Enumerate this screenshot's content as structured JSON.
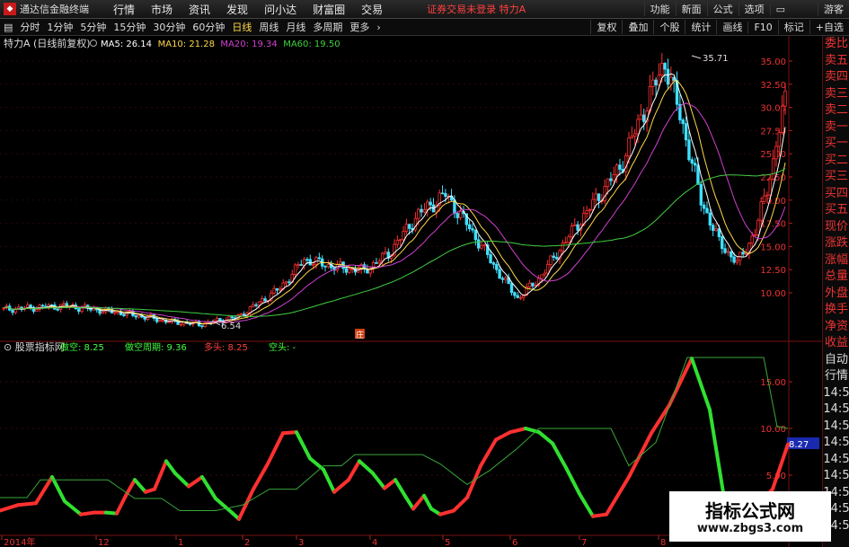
{
  "titlebar": {
    "app_title": "通达信金融终端",
    "menu": [
      "行情",
      "市场",
      "资讯",
      "发现",
      "问小达",
      "财富圈",
      "交易"
    ],
    "warning": "证券交易未登录  特力A",
    "right": [
      "功能",
      "新面",
      "公式",
      "选项"
    ],
    "user": "游客"
  },
  "periodbar": {
    "periods": [
      "分时",
      "1分钟",
      "5分钟",
      "15分钟",
      "30分钟",
      "60分钟",
      "日线",
      "周线",
      "月线",
      "多周期",
      "更多"
    ],
    "active": "日线",
    "tools": [
      "复权",
      "叠加",
      "个股",
      "统计",
      "画线",
      "F10",
      "标记",
      "+自选"
    ]
  },
  "main_chart": {
    "legend_title": "特力A (日线前复权)",
    "ma_labels": [
      {
        "name": "MA5",
        "value": "26.14",
        "color": "#ffffff"
      },
      {
        "name": "MA10",
        "value": "21.28",
        "color": "#ffd84a"
      },
      {
        "name": "MA20",
        "value": "19.34",
        "color": "#d040d0"
      },
      {
        "name": "MA60",
        "value": "19.50",
        "color": "#40d040"
      }
    ],
    "y_ticks": [
      "35.00",
      "32.50",
      "30.00",
      "27.50",
      "25.00",
      "22.50",
      "20.00",
      "17.50",
      "15.00",
      "12.50",
      "10.00"
    ],
    "high_label": "35.71",
    "low_label": "6.54",
    "marker": "庄"
  },
  "indicator": {
    "title": "股票指标网",
    "items": [
      {
        "label": "做空:",
        "value": "8.25",
        "color": "#40ff40"
      },
      {
        "label": "做空周期:",
        "value": "9.36",
        "color": "#40ff40"
      },
      {
        "label": "多头:",
        "value": "8.25",
        "color": "#ff4040"
      },
      {
        "label": "空头:",
        "value": "-",
        "color": "#40ff40"
      }
    ],
    "y_ticks": [
      "15.00",
      "10.00",
      "5.00"
    ],
    "current_value": "8.27"
  },
  "x_axis": [
    "2014年",
    "12",
    "1",
    "2",
    "3",
    "4",
    "5",
    "6",
    "7",
    "8"
  ],
  "right_panel": [
    "委比",
    "卖五",
    "卖四",
    "卖三",
    "卖二",
    "卖一",
    "买一",
    "买二",
    "买三",
    "买四",
    "买五",
    "现价",
    "涨跌",
    "涨幅",
    "总量",
    "外盘",
    "换手",
    "净资",
    "收益",
    "自动",
    "行情",
    "14:5",
    "14:5",
    "14:5",
    "14:5",
    "14:5",
    "14:5",
    "14:5",
    "14:5",
    "14:5"
  ],
  "watermark": {
    "line1": "指标公式网",
    "line2": "www.zbgs3.com"
  },
  "colors": {
    "up": "#ff3030",
    "down": "#40e0ff",
    "ma5": "#ffffff",
    "ma10": "#ffd84a",
    "ma20": "#d040d0",
    "ma60": "#40d040"
  }
}
